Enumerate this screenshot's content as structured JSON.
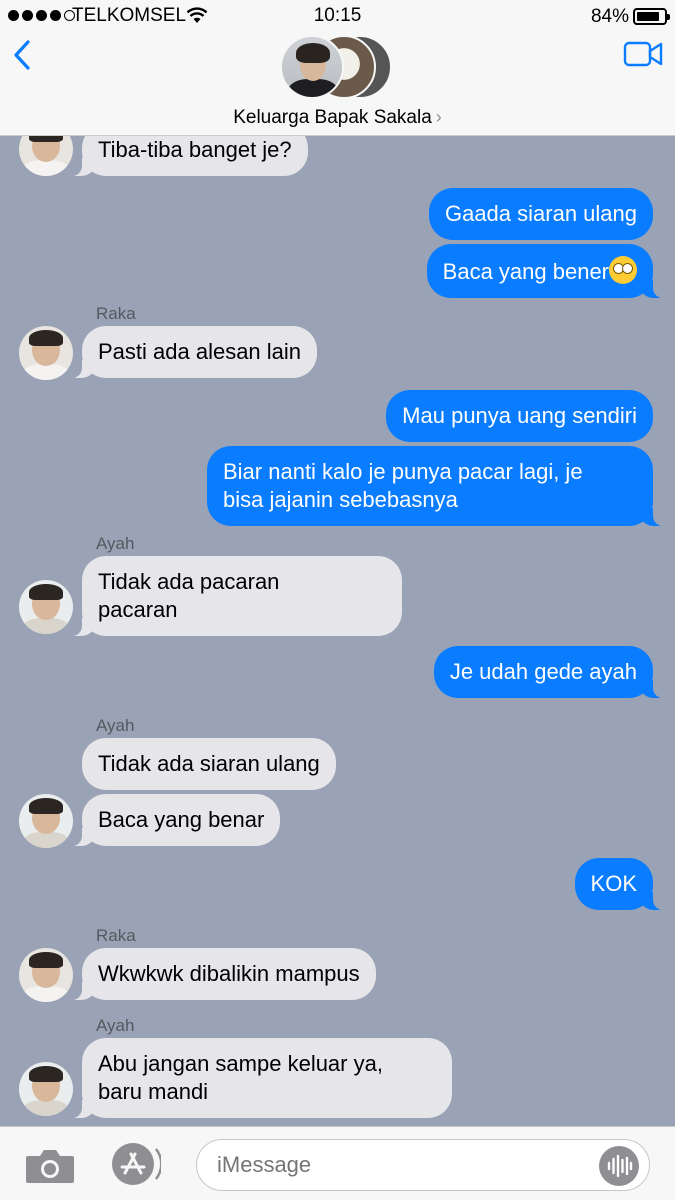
{
  "status_bar": {
    "carrier": "TELKOMSEL",
    "time": "10:15",
    "battery_percent_label": "84%",
    "battery_level": 0.84,
    "signal_bars": 4
  },
  "header": {
    "group_name": "Keluarga Bapak Sakala",
    "icons": {
      "back": "chevron-left-icon",
      "video": "video-camera-icon",
      "disclosure": "chevron-right-icon"
    }
  },
  "messages": [
    {
      "side": "in",
      "sender": "",
      "text": "Tiba-tiba banget je?",
      "avatar": "raka"
    },
    {
      "side": "out",
      "text": "Gaada siaran ulang"
    },
    {
      "side": "out",
      "text": "Baca yang bener",
      "emoji": "eye-roll-emoji"
    },
    {
      "side": "in",
      "sender": "Raka",
      "text": "Pasti ada alesan lain",
      "avatar": "raka"
    },
    {
      "side": "out",
      "text": "Mau punya uang sendiri"
    },
    {
      "side": "out",
      "lines": [
        "Biar nanti kalo je punya pacar lagi, je",
        "bisa jajanin sebebasnya"
      ]
    },
    {
      "side": "in",
      "sender": "Ayah",
      "lines": [
        "Tidak ada pacaran",
        "pacaran"
      ],
      "avatar": "ayah"
    },
    {
      "side": "out",
      "text": "Je udah gede ayah"
    },
    {
      "side": "in",
      "sender": "Ayah",
      "text": "Tidak ada siaran ulang"
    },
    {
      "side": "in",
      "text": "Baca yang benar",
      "avatar": "ayah"
    },
    {
      "side": "out",
      "text": "KOK"
    },
    {
      "side": "in",
      "sender": "Raka",
      "text": "Wkwkwk dibalikin mampus",
      "avatar": "raka"
    },
    {
      "side": "in",
      "sender": "Ayah",
      "lines": [
        "Abu jangan sampe keluar ya,",
        "baru mandi"
      ],
      "avatar": "ayah"
    }
  ],
  "composer": {
    "placeholder": "iMessage",
    "icons": {
      "camera": "camera-icon",
      "apps": "app-store-icon",
      "audio": "audio-waveform-icon"
    }
  }
}
